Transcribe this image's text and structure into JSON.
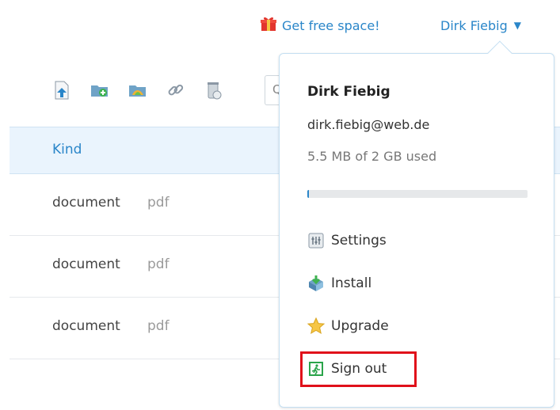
{
  "topbar": {
    "free_space_label": "Get free space!",
    "user_name": "Dirk Fiebig",
    "caret": "▼"
  },
  "toolbar": {
    "search_glyph": "Q",
    "icons": [
      "upload-file-icon",
      "new-folder-icon",
      "photo-folder-icon",
      "link-icon",
      "trash-icon"
    ]
  },
  "table": {
    "header": {
      "kind": "Kind"
    },
    "rows": [
      {
        "kind": "document",
        "type": "pdf"
      },
      {
        "kind": "document",
        "type": "pdf"
      },
      {
        "kind": "document",
        "type": "pdf"
      }
    ]
  },
  "popover": {
    "name": "Dirk Fiebig",
    "email": "dirk.fiebig@web.de",
    "usage": "5.5 MB of 2 GB used",
    "usage_fraction": 0.003,
    "menu": [
      {
        "label": "Settings",
        "icon": "settings-icon"
      },
      {
        "label": "Install",
        "icon": "install-icon"
      },
      {
        "label": "Upgrade",
        "icon": "star-icon"
      },
      {
        "label": "Sign out",
        "icon": "exit-icon"
      }
    ]
  },
  "colors": {
    "accent": "#2a86c9",
    "highlight": "#e0101a"
  }
}
